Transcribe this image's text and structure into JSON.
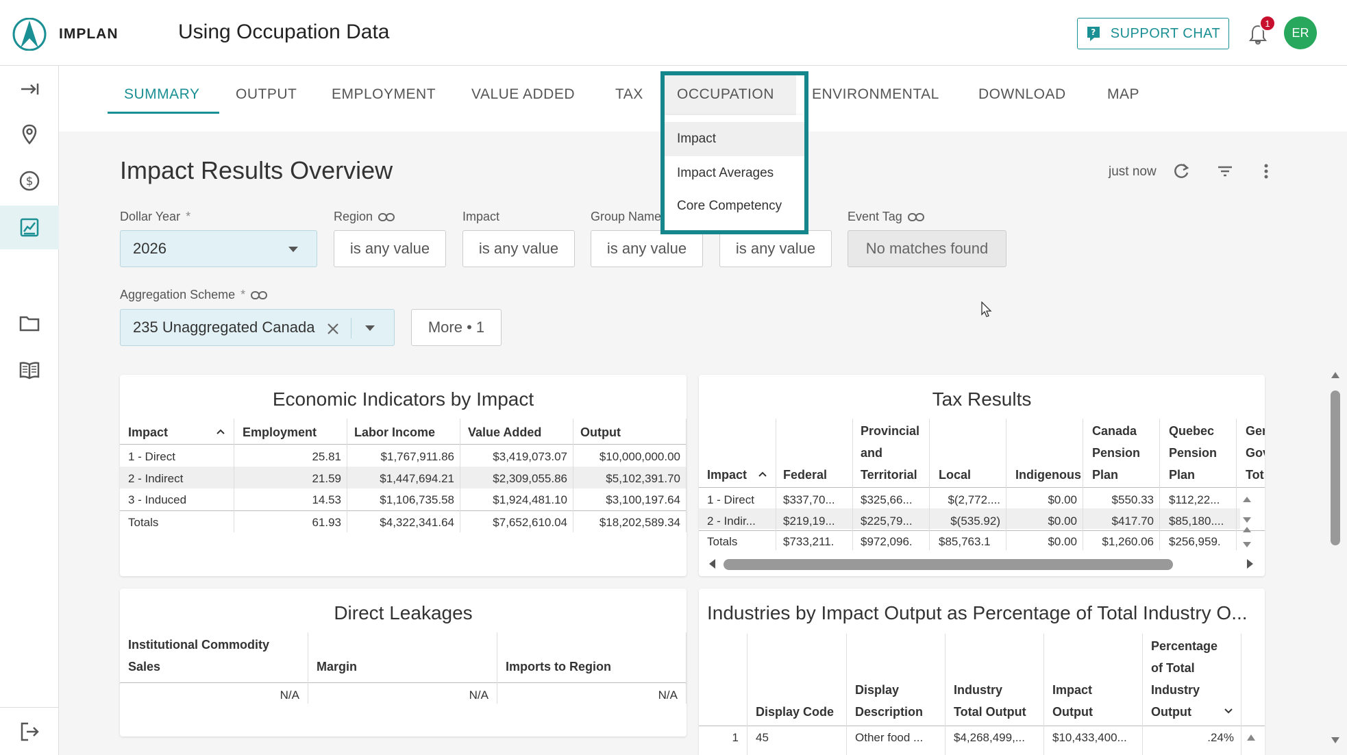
{
  "app": {
    "logo_text": "IMPLAN",
    "page_title": "Using Occupation Data"
  },
  "header": {
    "support_label": "SUPPORT CHAT",
    "notification_count": "1",
    "avatar_initials": "ER"
  },
  "tabs": [
    "SUMMARY",
    "OUTPUT",
    "EMPLOYMENT",
    "VALUE ADDED",
    "TAX",
    "OCCUPATION",
    "ENVIRONMENTAL",
    "DOWNLOAD",
    "MAP"
  ],
  "occupation_menu": [
    "Impact",
    "Impact Averages",
    "Core Competency"
  ],
  "overview": {
    "title": "Impact Results Overview",
    "updated": "just now"
  },
  "filters": {
    "dollar_year_label": "Dollar Year",
    "dollar_year_value": "2026",
    "region_label": "Region",
    "region_value": "is any value",
    "impact_label": "Impact",
    "impact_value": "is any value",
    "group_label": "Group Name",
    "group_value": "is any value",
    "hidden_value": "is any value",
    "event_tag_label": "Event Tag",
    "event_tag_value": "No matches found",
    "aggregation_label": "Aggregation Scheme",
    "aggregation_value": "235 Unaggregated Canada",
    "more_label": "More • 1",
    "required_mark": "*"
  },
  "economic": {
    "title": "Economic Indicators by Impact",
    "headers": [
      "Impact",
      "Employment",
      "Labor Income",
      "Value Added",
      "Output"
    ],
    "rows": [
      [
        "1 - Direct",
        "25.81",
        "$1,767,911.86",
        "$3,419,073.07",
        "$10,000,000.00"
      ],
      [
        "2 - Indirect",
        "21.59",
        "$1,447,694.21",
        "$2,309,055.86",
        "$5,102,391.70"
      ],
      [
        "3 - Induced",
        "14.53",
        "$1,106,735.58",
        "$1,924,481.10",
        "$3,100,197.64"
      ],
      [
        "Totals",
        "61.93",
        "$4,322,341.64",
        "$7,652,610.04",
        "$18,202,589.34"
      ]
    ]
  },
  "tax": {
    "title": "Tax Results",
    "headers": [
      "Impact",
      "Federal",
      "Provincial and Territorial",
      "Local",
      "Indigenous",
      "Canada Pension Plan",
      "Quebec Pension Plan",
      "Ger Gov Tot"
    ],
    "header_lines": [
      [
        "Impact"
      ],
      [
        "Federal"
      ],
      [
        "Provincial",
        "and",
        "Territorial"
      ],
      [
        "Local"
      ],
      [
        "Indigenous"
      ],
      [
        "Canada",
        "Pension",
        "Plan"
      ],
      [
        "Quebec",
        "Pension",
        "Plan"
      ],
      [
        "Ger",
        "Gov",
        "Tot"
      ]
    ],
    "rows": [
      [
        "1 - Direct",
        "$337,70...",
        "$325,66...",
        "$(2,772....",
        "$0.00",
        "$550.33",
        "$112,22..."
      ],
      [
        "2 - Indir...",
        "$219,19...",
        "$225,79...",
        "$(535.92)",
        "$0.00",
        "$417.70",
        "$85,180...."
      ],
      [
        "Totals",
        "$733,211.",
        "$972,096.",
        "$85,763.1",
        "$0.00",
        "$1,260.06",
        "$256,959."
      ]
    ]
  },
  "leakages": {
    "title": "Direct Leakages",
    "headers": [
      "Institutional Commodity Sales",
      "Margin",
      "Imports to Region"
    ],
    "header_lines": [
      [
        "Institutional Commodity",
        "Sales"
      ],
      [
        "Margin"
      ],
      [
        "Imports to Region"
      ]
    ],
    "row": [
      "N/A",
      "N/A",
      "N/A"
    ]
  },
  "industries": {
    "title": "Industries by Impact Output as Percentage of Total Industry O...",
    "headers": [
      "Display Code",
      "Display Description",
      "Industry Total Output",
      "Impact Output",
      "Percentage of Total Industry Output"
    ],
    "header_lines": [
      [
        "Display Code"
      ],
      [
        "Display",
        "Description"
      ],
      [
        "Industry",
        "Total Output"
      ],
      [
        "Impact",
        "Output"
      ],
      [
        "Percentage",
        "of Total",
        "Industry",
        "Output"
      ]
    ],
    "row": [
      "1",
      "45",
      "Other food ...",
      "$4,268,499,...",
      "$10,433,400...",
      ".24%"
    ]
  },
  "colors": {
    "accent": "#1a8f94",
    "highlight_border": "#15868c",
    "badge": "#c8102e",
    "avatar": "#28a85c"
  }
}
